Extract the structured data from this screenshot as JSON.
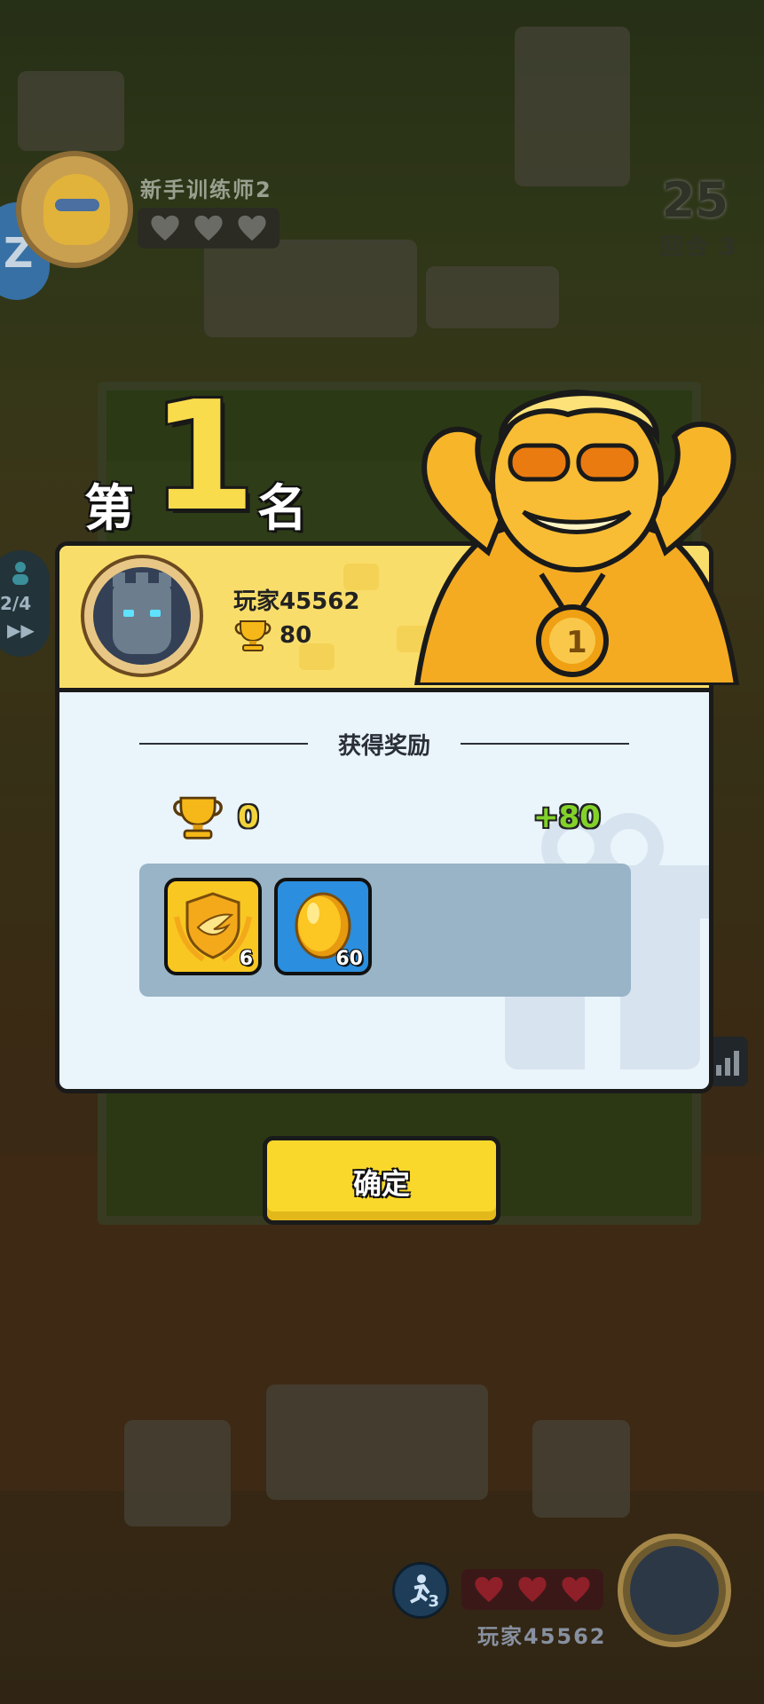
{
  "hud": {
    "opponent_name": "新手训练师2",
    "timer": "25",
    "round_label": "回合 3",
    "side_progress": "2/4",
    "self_name": "玩家45562",
    "skill_count": "3"
  },
  "result": {
    "rank_prefix": "第",
    "rank_number": "1",
    "rank_suffix": "名",
    "player_name": "玩家45562",
    "player_trophies": "80",
    "reward_title": "获得奖励",
    "trophy_before": "0",
    "trophy_gain": "+80",
    "rewards": [
      {
        "icon": "wing-shield-icon",
        "count": "6"
      },
      {
        "icon": "gold-coin-icon",
        "count": "60"
      }
    ],
    "confirm_label": "确定"
  },
  "colors": {
    "accent_yellow": "#f9d82b",
    "gain_green": "#82d22a",
    "card_bg": "#eaf4fb",
    "header_bg": "#f9dd6a"
  }
}
